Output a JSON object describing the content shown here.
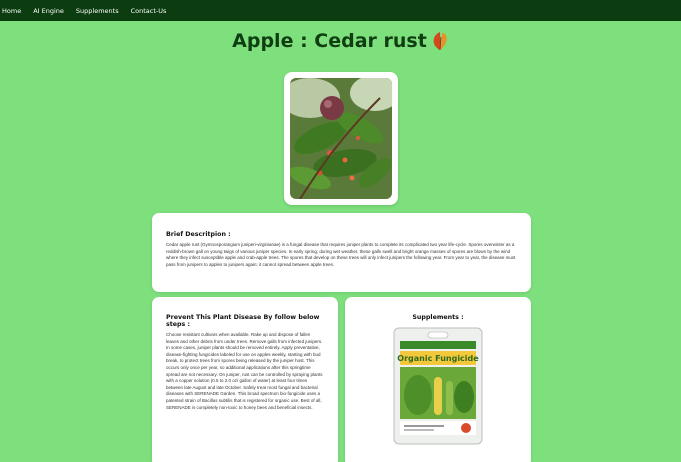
{
  "nav": {
    "items": [
      "Home",
      "AI Engine",
      "Supplements",
      "Contact-Us"
    ]
  },
  "page": {
    "title": "Apple : Cedar rust"
  },
  "brief": {
    "heading": "Brief Descritpion :",
    "text": "Cedar apple rust (Gymnosporangium juniperi-virginianae) is a fungal disease that requires juniper plants to complete its complicated two year life-cycle. Spores overwinter as a reddish-brown gall on young twigs of various juniper species. In early spring, during wet weather, these galls swell and bright orange masses of spores are blown by the wind where they infect susceptible apple and crab-apple trees. The spores that develop on these trees will only infect junipers the following year. From year to year, the disease must pass from junipers to apples to junipers again; it cannot spread between apple trees."
  },
  "prevent": {
    "heading": "Prevent This Plant Disease By follow below steps :",
    "text": "Choose resistant cultivars when available. Rake up and dispose of fallen leaves and other debris from under trees. Remove galls from infected junipers. In some cases, juniper plants should be removed entirely. Apply preventative, disease-fighting fungicides labeled for use on apples weekly, starting with bud break, to protect trees from spores being released by the juniper host. This occurs only once per year, so additional applications after this springtime spread are not necessary. On juniper, rust can be controlled by spraying plants with a copper solution (0.5 to 2.0 oz/ gallon of water) at least four times between late August and late October. Safely treat most fungal and bacterial diseases with SERENADE Garden. This broad spectrum bio-fungicide uses a patented strain of Bacillus subtilis that is registered for organic use. Best of all, SERENADE is completely non-toxic to honey bees and beneficial insects."
  },
  "supplements": {
    "heading": "Supplements :",
    "product_label": "Organic Fungicide"
  },
  "colors": {
    "background": "#7de07d",
    "navbar": "#0b3d10",
    "title": "#103e12"
  }
}
